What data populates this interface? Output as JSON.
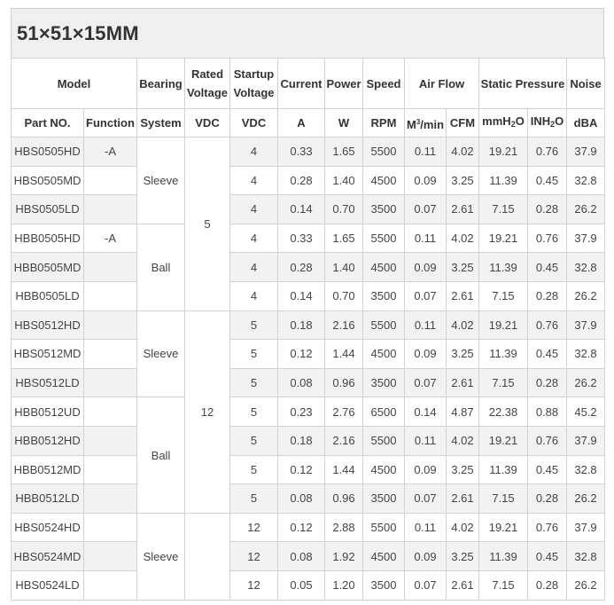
{
  "title": "51×51×15MM",
  "header": {
    "model": "Model",
    "bearing": "Bearing",
    "rated_voltage_1": "Rated",
    "rated_voltage_2": "Voltage",
    "startup_voltage_1": "Startup",
    "startup_voltage_2": "Voltage",
    "current": "Current",
    "power": "Power",
    "speed": "Speed",
    "air_flow": "Air Flow",
    "static_pressure": "Static Pressure",
    "noise": "Noise"
  },
  "subheader": {
    "part_no": "Part NO.",
    "function": "Function",
    "system": "System",
    "vdc1": "VDC",
    "vdc2": "VDC",
    "a": "A",
    "w": "W",
    "rpm": "RPM",
    "m3min_base": "M",
    "m3min_sup": "3",
    "m3min_tail": "/min",
    "cfm": "CFM",
    "mmh2o_base": "mmH",
    "mmh2o_sub": "2",
    "mmh2o_tail": "O",
    "inh2o_base": "INH",
    "inh2o_sub": "2",
    "inh2o_tail": "O",
    "dba": "dBA"
  },
  "groups": {
    "sleeve_1": "Sleeve",
    "ball_1": "Ball",
    "sleeve_2": "Sleeve",
    "ball_2": "Ball",
    "sleeve_3": "Sleeve",
    "voltage_5": "5",
    "voltage_12": "12"
  },
  "rows": [
    {
      "part": "HBS0505HD",
      "function": "-A",
      "startup": "4",
      "current": "0.33",
      "power": "1.65",
      "speed": "5500",
      "m3": "0.11",
      "cfm": "4.02",
      "mmh2o": "19.21",
      "inh2o": "0.76",
      "dba": "37.9"
    },
    {
      "part": "HBS0505MD",
      "function": "",
      "startup": "4",
      "current": "0.28",
      "power": "1.40",
      "speed": "4500",
      "m3": "0.09",
      "cfm": "3.25",
      "mmh2o": "11.39",
      "inh2o": "0.45",
      "dba": "32.8"
    },
    {
      "part": "HBS0505LD",
      "function": "",
      "startup": "4",
      "current": "0.14",
      "power": "0.70",
      "speed": "3500",
      "m3": "0.07",
      "cfm": "2.61",
      "mmh2o": "7.15",
      "inh2o": "0.28",
      "dba": "26.2"
    },
    {
      "part": "HBB0505HD",
      "function": "-A",
      "startup": "4",
      "current": "0.33",
      "power": "1.65",
      "speed": "5500",
      "m3": "0.11",
      "cfm": "4.02",
      "mmh2o": "19.21",
      "inh2o": "0.76",
      "dba": "37.9"
    },
    {
      "part": "HBB0505MD",
      "function": "",
      "startup": "4",
      "current": "0.28",
      "power": "1.40",
      "speed": "4500",
      "m3": "0.09",
      "cfm": "3.25",
      "mmh2o": "11.39",
      "inh2o": "0.45",
      "dba": "32.8"
    },
    {
      "part": "HBB0505LD",
      "function": "",
      "startup": "4",
      "current": "0.14",
      "power": "0.70",
      "speed": "3500",
      "m3": "0.07",
      "cfm": "2.61",
      "mmh2o": "7.15",
      "inh2o": "0.28",
      "dba": "26.2"
    },
    {
      "part": "HBS0512HD",
      "function": "",
      "startup": "5",
      "current": "0.18",
      "power": "2.16",
      "speed": "5500",
      "m3": "0.11",
      "cfm": "4.02",
      "mmh2o": "19.21",
      "inh2o": "0.76",
      "dba": "37.9"
    },
    {
      "part": "HBS0512MD",
      "function": "",
      "startup": "5",
      "current": "0.12",
      "power": "1.44",
      "speed": "4500",
      "m3": "0.09",
      "cfm": "3.25",
      "mmh2o": "11.39",
      "inh2o": "0.45",
      "dba": "32.8"
    },
    {
      "part": "HBS0512LD",
      "function": "",
      "startup": "5",
      "current": "0.08",
      "power": "0.96",
      "speed": "3500",
      "m3": "0.07",
      "cfm": "2.61",
      "mmh2o": "7.15",
      "inh2o": "0.28",
      "dba": "26.2"
    },
    {
      "part": "HBB0512UD",
      "function": "",
      "startup": "5",
      "current": "0.23",
      "power": "2.76",
      "speed": "6500",
      "m3": "0.14",
      "cfm": "4.87",
      "mmh2o": "22.38",
      "inh2o": "0.88",
      "dba": "45.2"
    },
    {
      "part": "HBB0512HD",
      "function": "",
      "startup": "5",
      "current": "0.18",
      "power": "2.16",
      "speed": "5500",
      "m3": "0.11",
      "cfm": "4.02",
      "mmh2o": "19.21",
      "inh2o": "0.76",
      "dba": "37.9"
    },
    {
      "part": "HBB0512MD",
      "function": "",
      "startup": "5",
      "current": "0.12",
      "power": "1.44",
      "speed": "4500",
      "m3": "0.09",
      "cfm": "3.25",
      "mmh2o": "11.39",
      "inh2o": "0.45",
      "dba": "32.8"
    },
    {
      "part": "HBB0512LD",
      "function": "",
      "startup": "5",
      "current": "0.08",
      "power": "0.96",
      "speed": "3500",
      "m3": "0.07",
      "cfm": "2.61",
      "mmh2o": "7.15",
      "inh2o": "0.28",
      "dba": "26.2"
    },
    {
      "part": "HBS0524HD",
      "function": "",
      "startup": "12",
      "current": "0.12",
      "power": "2.88",
      "speed": "5500",
      "m3": "0.11",
      "cfm": "4.02",
      "mmh2o": "19.21",
      "inh2o": "0.76",
      "dba": "37.9"
    },
    {
      "part": "HBS0524MD",
      "function": "",
      "startup": "12",
      "current": "0.08",
      "power": "1.92",
      "speed": "4500",
      "m3": "0.09",
      "cfm": "3.25",
      "mmh2o": "11.39",
      "inh2o": "0.45",
      "dba": "32.8"
    },
    {
      "part": "HBS0524LD",
      "function": "",
      "startup": "12",
      "current": "0.05",
      "power": "1.20",
      "speed": "3500",
      "m3": "0.07",
      "cfm": "2.61",
      "mmh2o": "7.15",
      "inh2o": "0.28",
      "dba": "26.2"
    }
  ],
  "colors": {
    "stripe": "#f2f2f2",
    "border": "#d2d2d2",
    "title_bg": "#efefef"
  }
}
